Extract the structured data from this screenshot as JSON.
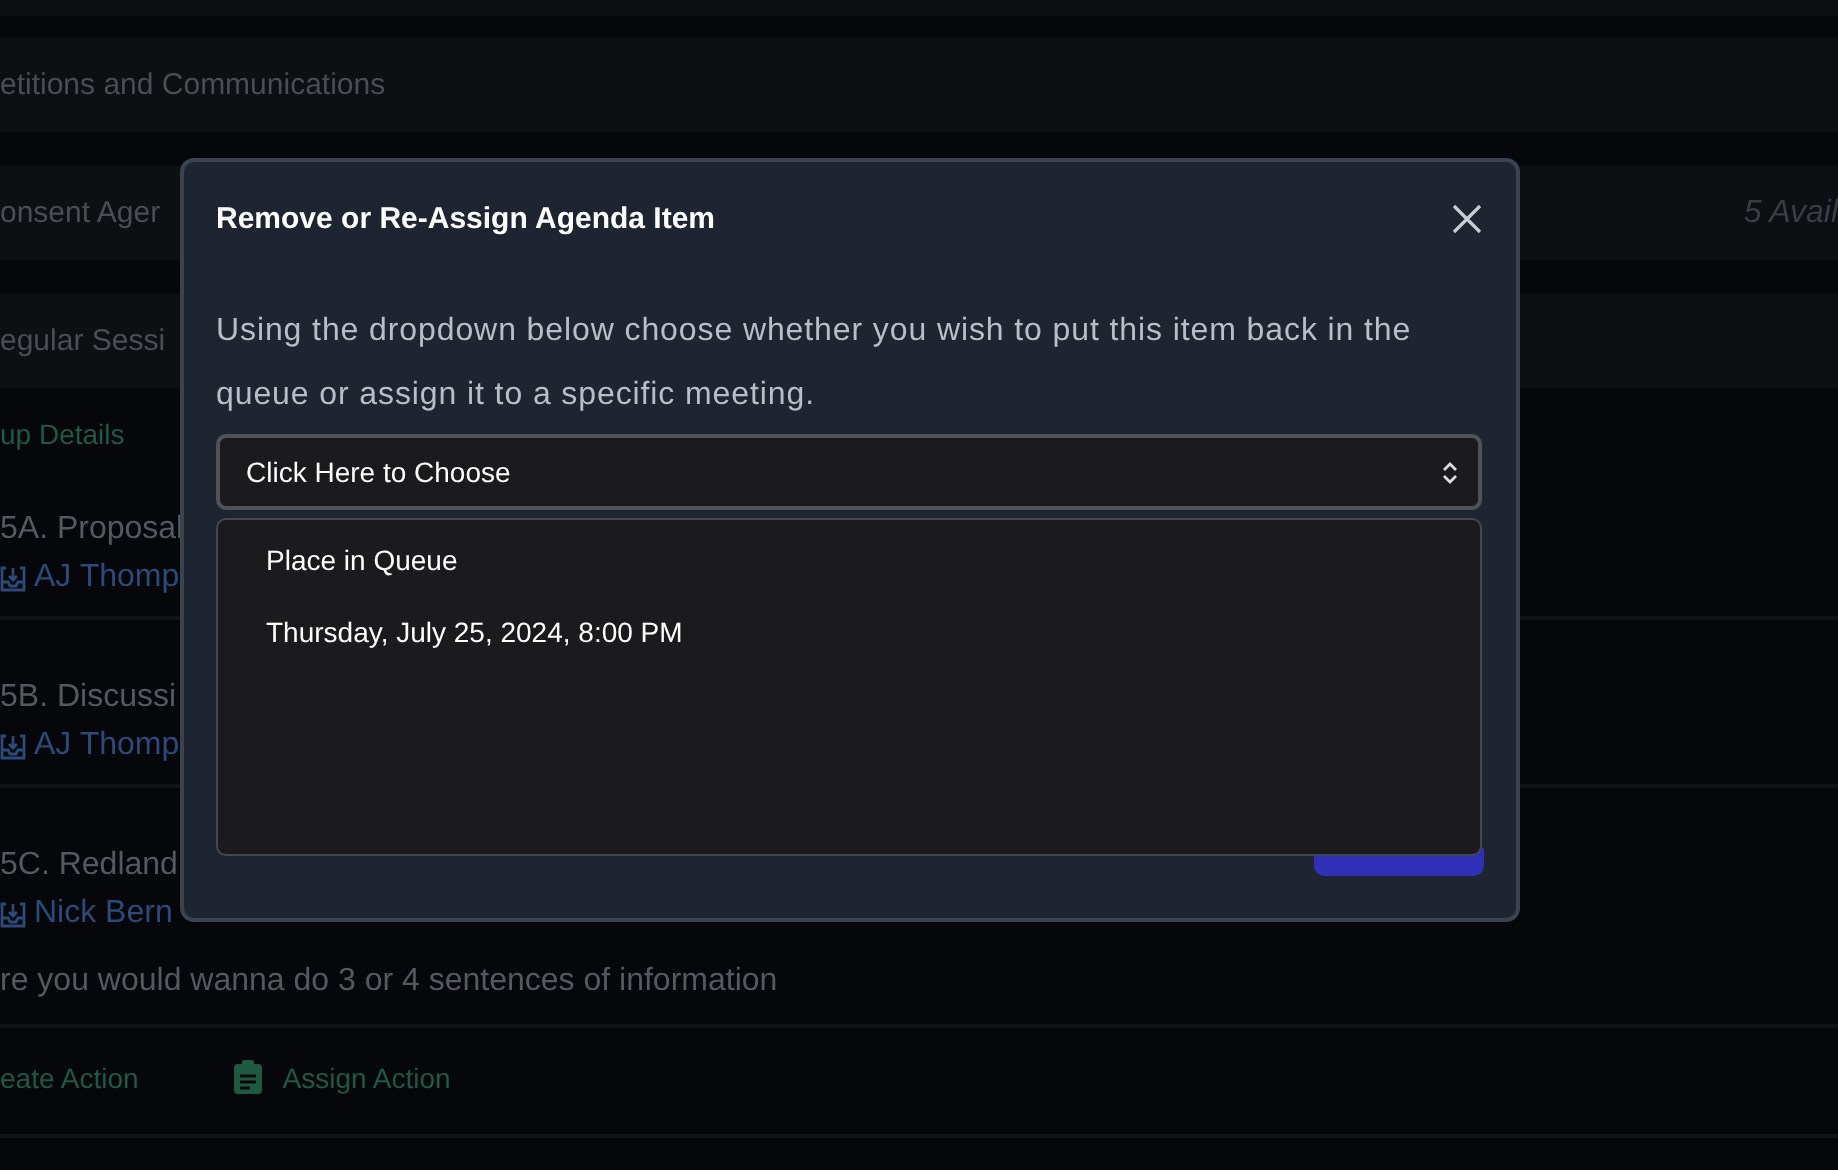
{
  "background": {
    "sections": [
      {
        "title": "etitions and Communications"
      },
      {
        "title": "onsent Ager",
        "count": "5 Avail"
      },
      {
        "title": "egular Sessi"
      }
    ],
    "details_link": "up Details",
    "items": [
      {
        "title": "5A. Proposal",
        "author": "AJ Thomp"
      },
      {
        "title": "5B. Discussi",
        "author": "AJ Thomp"
      },
      {
        "title": "5C. Redland",
        "author": "Nick Bern",
        "description": "re you would wanna do 3 or 4 sentences of information"
      }
    ],
    "actions": [
      {
        "label": "eate Action"
      },
      {
        "label": "Assign Action"
      }
    ]
  },
  "dialog": {
    "title": "Remove or Re-Assign Agenda Item",
    "message": "Using the dropdown below choose whether you wish to put this item back in the queue or assign it to a specific meeting.",
    "select": {
      "value": "Click Here to Choose"
    },
    "options": [
      {
        "label": "Place in Queue"
      },
      {
        "label": "Thursday, July 25, 2024, 8:00 PM"
      }
    ]
  }
}
